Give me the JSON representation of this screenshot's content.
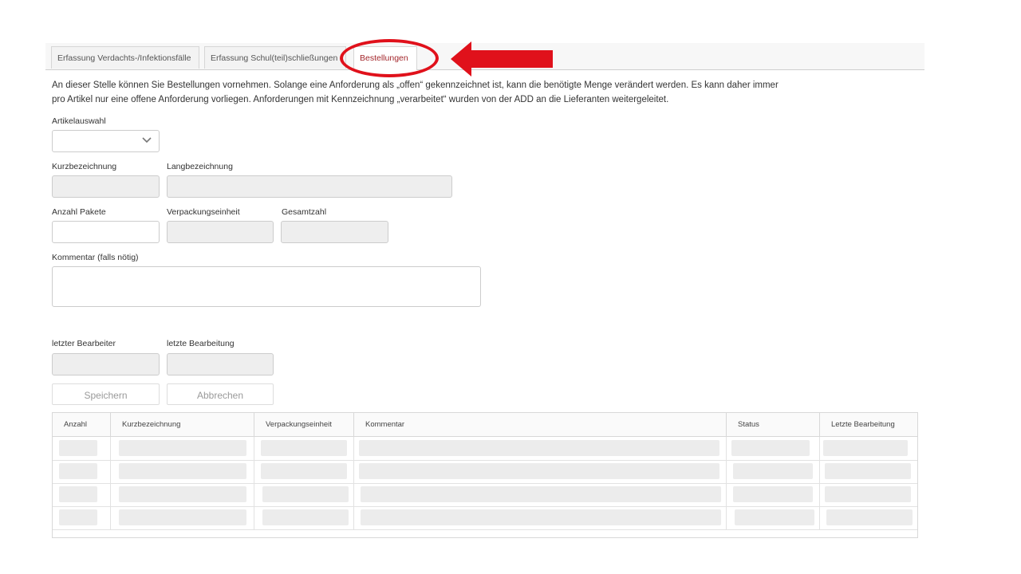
{
  "tabs": [
    {
      "label": "Erfassung Verdachts-/Infektionsfälle"
    },
    {
      "label": "Erfassung Schul(teil)schließungen"
    },
    {
      "label": "Bestellungen"
    }
  ],
  "description": "An dieser Stelle können Sie Bestellungen vornehmen. Solange eine Anforderung als „offen“ gekennzeichnet ist, kann die benötigte Menge verändert werden. Es kann daher immer pro Artikel nur eine offene Anforderung vorliegen. Anforderungen mit Kennzeichnung „verarbeitet“ wurden von der ADD an die Lieferanten weitergeleitet.",
  "form": {
    "artikelauswahl_label": "Artikelauswahl",
    "artikelauswahl_value": "",
    "kurzbezeichnung_label": "Kurzbezeichnung",
    "langbezeichnung_label": "Langbezeichnung",
    "anzahl_pakete_label": "Anzahl Pakete",
    "verpackungseinheit_label": "Verpackungseinheit",
    "gesamtzahl_label": "Gesamtzahl",
    "kommentar_label": "Kommentar (falls nötig)",
    "letzter_bearbeiter_label": "letzter Bearbeiter",
    "letzte_bearbeitung_label": "letzte Bearbeitung"
  },
  "buttons": {
    "save_label": "Speichern",
    "cancel_label": "Abbrechen"
  },
  "table": {
    "columns": [
      "Anzahl",
      "Kurzbezeichnung",
      "Verpackungseinheit",
      "Kommentar",
      "Status",
      "Letzte Bearbeitung"
    ]
  },
  "colors": {
    "active_tab_text": "#a3262b",
    "highlight": "#e0111b"
  },
  "icons": {
    "select_chevron": "chevron-down-icon",
    "annotation_arrow": "arrow-left-icon"
  }
}
